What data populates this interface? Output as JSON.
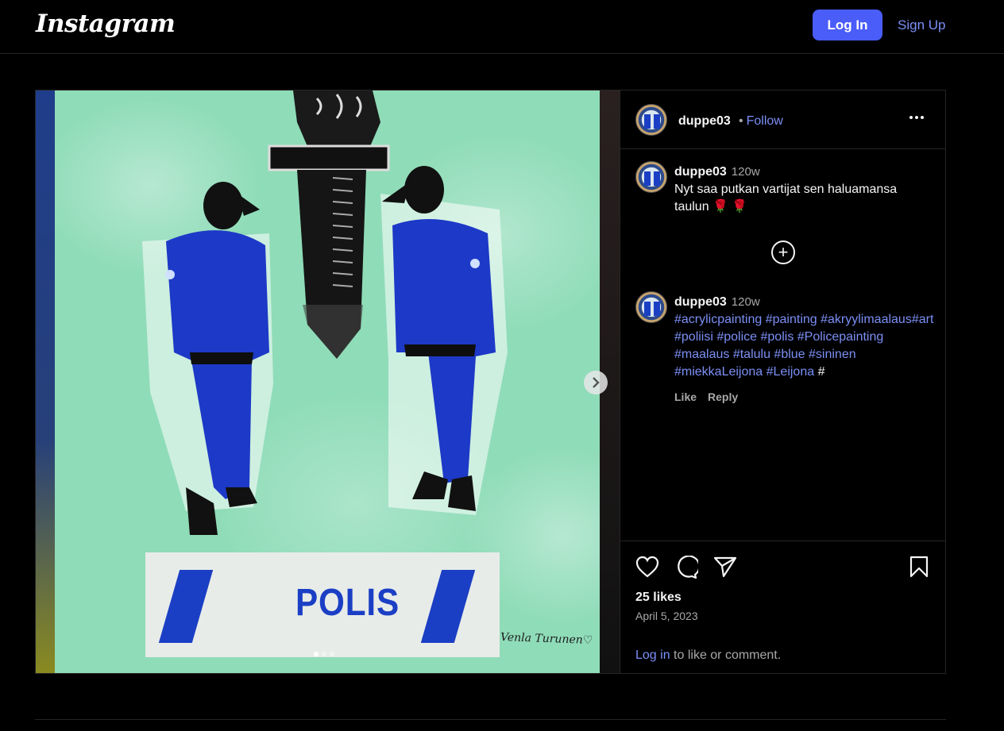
{
  "app": {
    "logo": "Instagram"
  },
  "header": {
    "login_label": "Log In",
    "signup_label": "Sign Up"
  },
  "media": {
    "painting_text": "POLIS",
    "signature": "Venla Turunen♡",
    "slide_count": 3,
    "active_slide": 1,
    "icons": {
      "next": "chevron-right-icon"
    }
  },
  "post": {
    "author": "duppe03",
    "follow_label": "Follow",
    "separator": "•",
    "caption": {
      "user": "duppe03",
      "time": "120w",
      "text": "Nyt saa putkan vartijat sen haluamansa taulun 🌹 🌹"
    },
    "reply": {
      "user": "duppe03",
      "time": "120w",
      "tags": "#acrylicpainting #painting #akryylimaalaus#art #poliisi #police #polis #Policepainting #maalaus #talulu #blue #sininen #miekkaLeijona #Leijona",
      "trailing": " #",
      "like_label": "Like",
      "reply_label": "Reply"
    },
    "likes": "25 likes",
    "date": "April 5, 2023",
    "login_link": "Log in",
    "login_rest": " to like or comment.",
    "icons": {
      "like": "heart-icon",
      "comment": "comment-icon",
      "share": "send-icon",
      "save": "bookmark-icon",
      "more": "more-icon",
      "add": "plus-circle-icon"
    }
  },
  "colors": {
    "accent": "#4a5df9",
    "link": "#7b8ff5",
    "background": "#000000",
    "border": "#262626"
  }
}
